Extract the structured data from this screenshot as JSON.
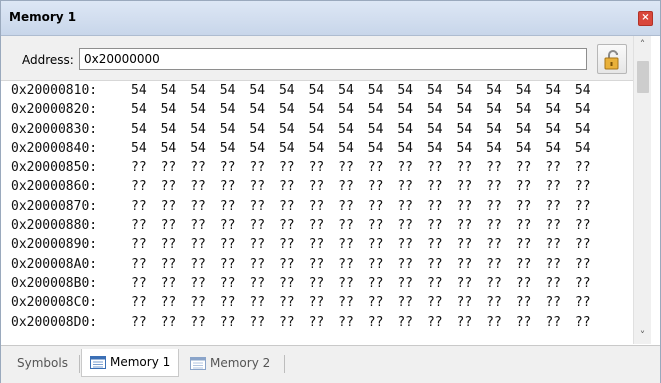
{
  "window": {
    "title": "Memory 1",
    "close_glyph": "×"
  },
  "toolbar": {
    "address_label": "Address:",
    "address_value": "0x20000000",
    "lock_icon": "lock-icon"
  },
  "memory": {
    "rows": [
      {
        "address": "0x20000810:",
        "bytes": [
          "54",
          "54",
          "54",
          "54",
          "54",
          "54",
          "54",
          "54",
          "54",
          "54",
          "54",
          "54",
          "54",
          "54",
          "54",
          "54"
        ]
      },
      {
        "address": "0x20000820:",
        "bytes": [
          "54",
          "54",
          "54",
          "54",
          "54",
          "54",
          "54",
          "54",
          "54",
          "54",
          "54",
          "54",
          "54",
          "54",
          "54",
          "54"
        ]
      },
      {
        "address": "0x20000830:",
        "bytes": [
          "54",
          "54",
          "54",
          "54",
          "54",
          "54",
          "54",
          "54",
          "54",
          "54",
          "54",
          "54",
          "54",
          "54",
          "54",
          "54"
        ]
      },
      {
        "address": "0x20000840:",
        "bytes": [
          "54",
          "54",
          "54",
          "54",
          "54",
          "54",
          "54",
          "54",
          "54",
          "54",
          "54",
          "54",
          "54",
          "54",
          "54",
          "54"
        ]
      },
      {
        "address": "0x20000850:",
        "bytes": [
          "??",
          "??",
          "??",
          "??",
          "??",
          "??",
          "??",
          "??",
          "??",
          "??",
          "??",
          "??",
          "??",
          "??",
          "??",
          "??"
        ]
      },
      {
        "address": "0x20000860:",
        "bytes": [
          "??",
          "??",
          "??",
          "??",
          "??",
          "??",
          "??",
          "??",
          "??",
          "??",
          "??",
          "??",
          "??",
          "??",
          "??",
          "??"
        ]
      },
      {
        "address": "0x20000870:",
        "bytes": [
          "??",
          "??",
          "??",
          "??",
          "??",
          "??",
          "??",
          "??",
          "??",
          "??",
          "??",
          "??",
          "??",
          "??",
          "??",
          "??"
        ]
      },
      {
        "address": "0x20000880:",
        "bytes": [
          "??",
          "??",
          "??",
          "??",
          "??",
          "??",
          "??",
          "??",
          "??",
          "??",
          "??",
          "??",
          "??",
          "??",
          "??",
          "??"
        ]
      },
      {
        "address": "0x20000890:",
        "bytes": [
          "??",
          "??",
          "??",
          "??",
          "??",
          "??",
          "??",
          "??",
          "??",
          "??",
          "??",
          "??",
          "??",
          "??",
          "??",
          "??"
        ]
      },
      {
        "address": "0x200008A0:",
        "bytes": [
          "??",
          "??",
          "??",
          "??",
          "??",
          "??",
          "??",
          "??",
          "??",
          "??",
          "??",
          "??",
          "??",
          "??",
          "??",
          "??"
        ]
      },
      {
        "address": "0x200008B0:",
        "bytes": [
          "??",
          "??",
          "??",
          "??",
          "??",
          "??",
          "??",
          "??",
          "??",
          "??",
          "??",
          "??",
          "??",
          "??",
          "??",
          "??"
        ]
      },
      {
        "address": "0x200008C0:",
        "bytes": [
          "??",
          "??",
          "??",
          "??",
          "??",
          "??",
          "??",
          "??",
          "??",
          "??",
          "??",
          "??",
          "??",
          "??",
          "??",
          "??"
        ]
      },
      {
        "address": "0x200008D0:",
        "bytes": [
          "??",
          "??",
          "??",
          "??",
          "??",
          "??",
          "??",
          "??",
          "??",
          "??",
          "??",
          "??",
          "??",
          "??",
          "??",
          "??"
        ]
      }
    ]
  },
  "scrollbar": {
    "up_glyph": "˄",
    "down_glyph": "˅"
  },
  "tabs": [
    {
      "label": "Symbols",
      "active": false,
      "icon": ""
    },
    {
      "label": "Memory 1",
      "active": true,
      "icon": "memory-window-icon"
    },
    {
      "label": "Memory 2",
      "active": false,
      "icon": "memory-window-icon"
    }
  ],
  "colors": {
    "titlebar": "#c8d6ea",
    "close": "#d9473b"
  }
}
